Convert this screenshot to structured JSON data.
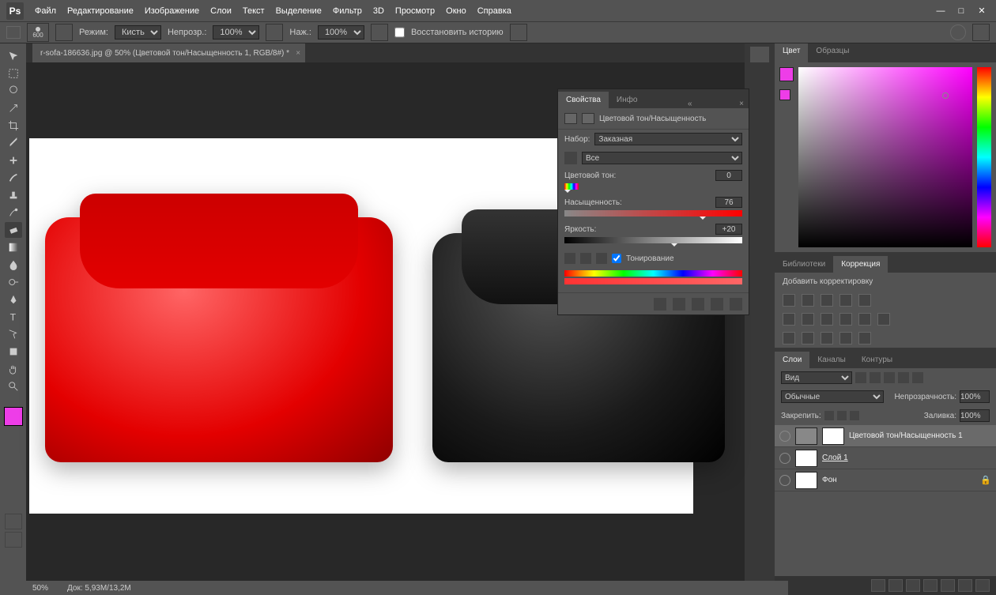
{
  "menu": {
    "items": [
      "Файл",
      "Редактирование",
      "Изображение",
      "Слои",
      "Текст",
      "Выделение",
      "Фильтр",
      "3D",
      "Просмотр",
      "Окно",
      "Справка"
    ]
  },
  "opt": {
    "mode_label": "Режим:",
    "mode_value": "Кисть",
    "opacity_label": "Непрозр.:",
    "opacity_value": "100%",
    "flow_label": "Наж.:",
    "flow_value": "100%",
    "history": "Восстановить историю",
    "brush_size": "600"
  },
  "doc": {
    "tab": "r-sofa-186636.jpg @ 50% (Цветовой тон/Насыщенность 1, RGB/8#) *"
  },
  "color": {
    "tab1": "Цвет",
    "tab2": "Образцы"
  },
  "correction": {
    "tab1": "Библиотеки",
    "tab2": "Коррекция",
    "add": "Добавить корректировку"
  },
  "layers": {
    "tab1": "Слои",
    "tab2": "Каналы",
    "tab3": "Контуры",
    "kind": "Вид",
    "blend": "Обычные",
    "opacity_label": "Непрозрачность:",
    "opacity": "100%",
    "lock_label": "Закрепить:",
    "fill_label": "Заливка:",
    "fill": "100%",
    "items": [
      {
        "name": "Цветовой тон/Насыщенность 1",
        "sel": true,
        "adj": true
      },
      {
        "name": "Слой 1",
        "sel": false,
        "u": true
      },
      {
        "name": "Фон",
        "sel": false,
        "lock": true
      }
    ]
  },
  "props": {
    "tab1": "Свойства",
    "tab2": "Инфо",
    "title": "Цветовой тон/Насыщенность",
    "preset_label": "Набор:",
    "preset": "Заказная",
    "range": "Все",
    "hue_label": "Цветовой тон:",
    "hue": "0",
    "sat_label": "Насыщенность:",
    "sat": "76",
    "lgt_label": "Яркость:",
    "lgt": "+20",
    "tint": "Тонирование"
  },
  "status": {
    "zoom": "50%",
    "doc": "Док: 5,93M/13,2M"
  }
}
